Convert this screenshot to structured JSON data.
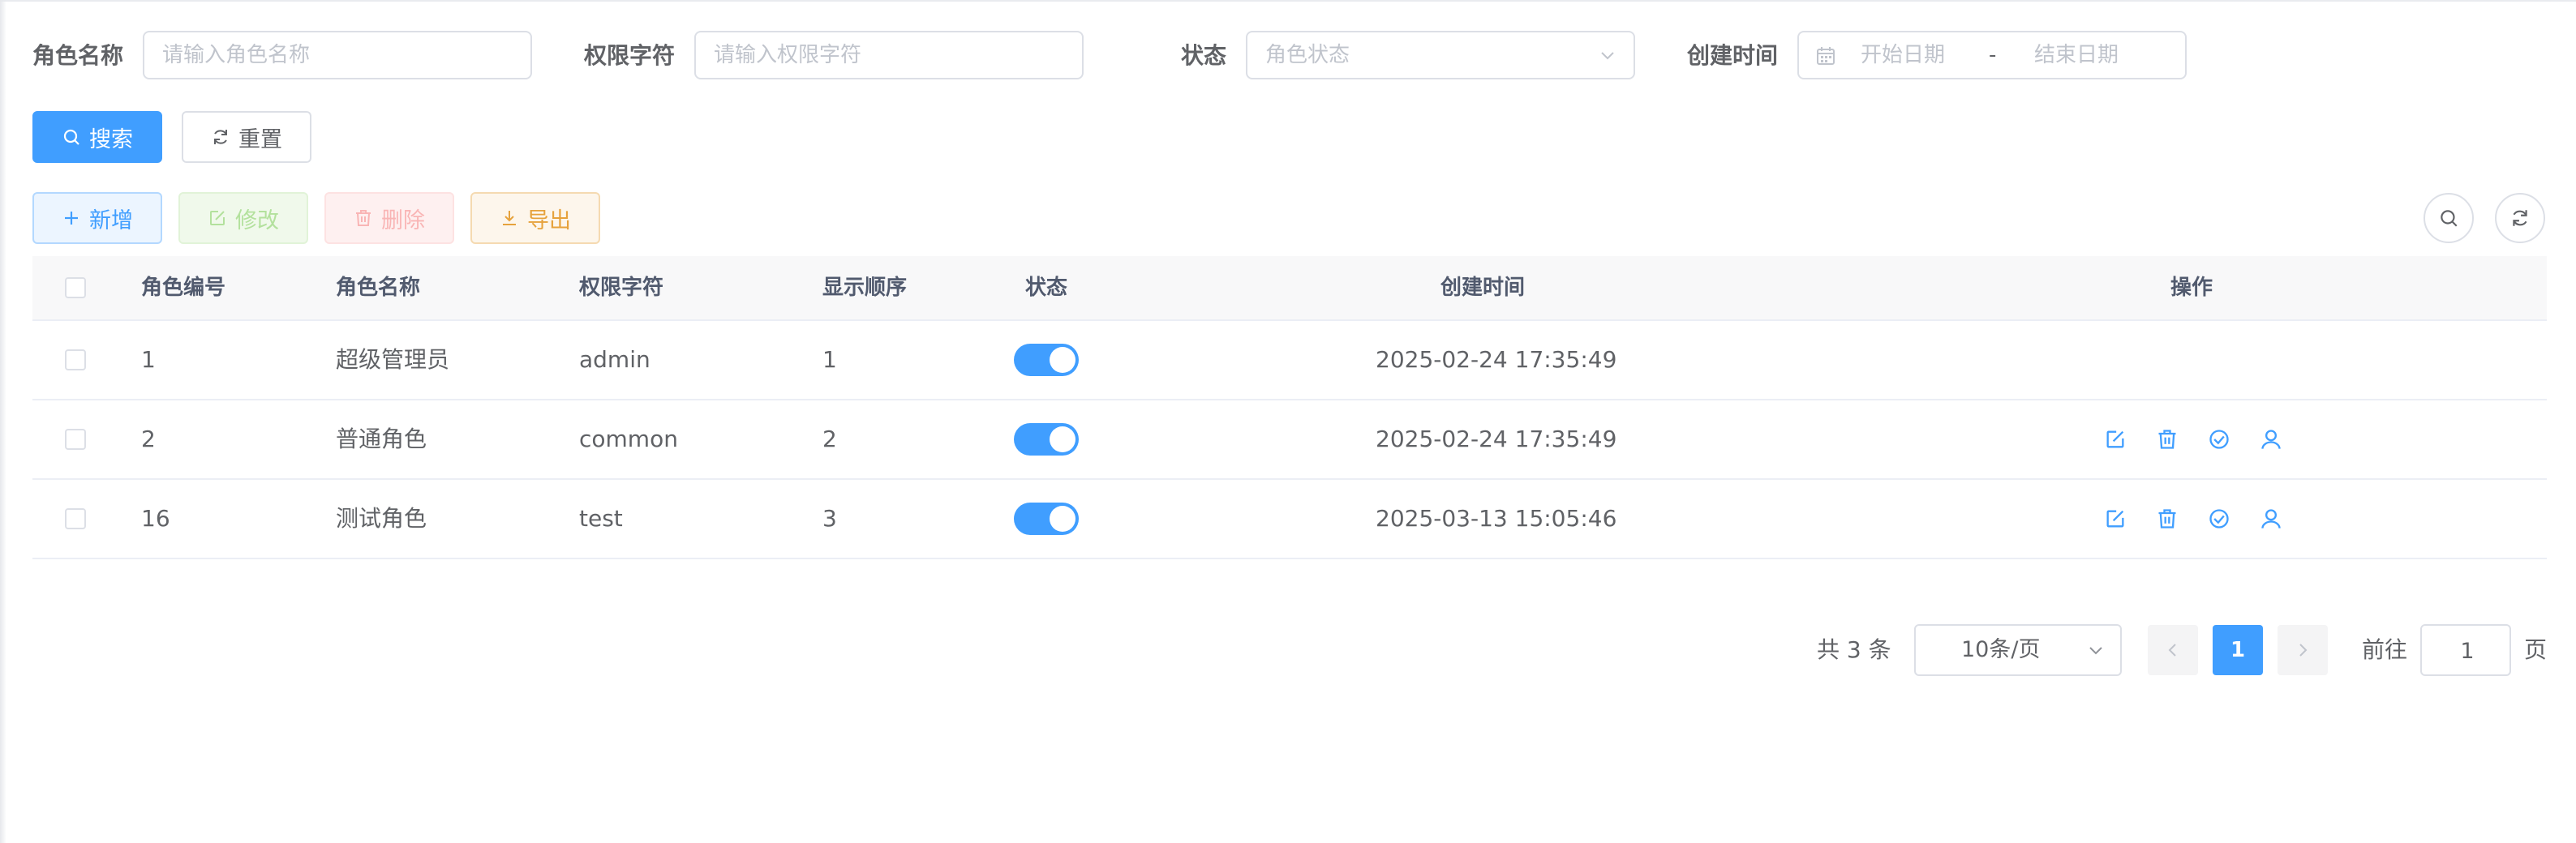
{
  "search": {
    "role_name_label": "角色名称",
    "role_name_placeholder": "请输入角色名称",
    "role_key_label": "权限字符",
    "role_key_placeholder": "请输入权限字符",
    "status_label": "状态",
    "status_placeholder": "角色状态",
    "created_label": "创建时间",
    "start_date_placeholder": "开始日期",
    "range_separator": "-",
    "end_date_placeholder": "结束日期",
    "search_button": "搜索",
    "reset_button": "重置"
  },
  "toolbar": {
    "add_label": "新增",
    "edit_label": "修改",
    "delete_label": "删除",
    "export_label": "导出",
    "right_icons": [
      "search-icon",
      "refresh-icon"
    ]
  },
  "table": {
    "columns": [
      "角色编号",
      "角色名称",
      "权限字符",
      "显示顺序",
      "状态",
      "创建时间",
      "操作"
    ],
    "rows": [
      {
        "id": "1",
        "name": "超级管理员",
        "key": "admin",
        "sort": "1",
        "status_on": true,
        "created": "2025-02-24 17:35:49",
        "actions": []
      },
      {
        "id": "2",
        "name": "普通角色",
        "key": "common",
        "sort": "2",
        "status_on": true,
        "created": "2025-02-24 17:35:49",
        "actions": [
          "edit-icon",
          "delete-icon",
          "data-scope-icon",
          "assign-user-icon"
        ]
      },
      {
        "id": "16",
        "name": "测试角色",
        "key": "test",
        "sort": "3",
        "status_on": true,
        "created": "2025-03-13 15:05:46",
        "actions": [
          "edit-icon",
          "delete-icon",
          "data-scope-icon",
          "assign-user-icon"
        ]
      }
    ]
  },
  "pagination": {
    "total_text": "共 3 条",
    "page_size": "10条/页",
    "current_page": "1",
    "goto_label": "前往",
    "goto_value": "1",
    "page_suffix": "页"
  },
  "colors": {
    "primary": "#409eff",
    "success": "#67c23a",
    "danger": "#f56c6c",
    "warning": "#e6a23c",
    "border": "#dcdfe6"
  }
}
